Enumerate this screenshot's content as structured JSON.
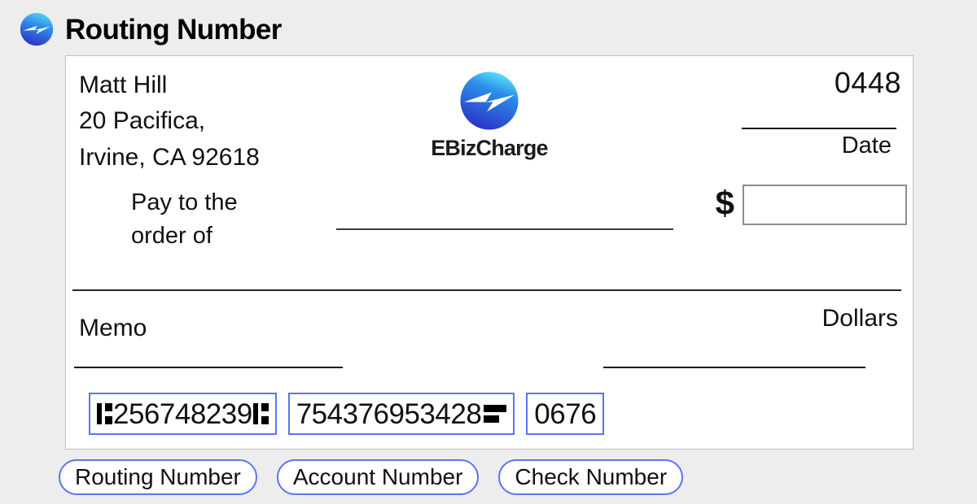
{
  "header": {
    "title": "Routing Number",
    "logo_icon": "ebizcharge-bolt-circle-icon"
  },
  "theme": {
    "page_background": "#ededed",
    "check_background": "#ffffff",
    "check_border": "#bdbdbd",
    "highlight_blue": "#5b74f0",
    "rule_color": "#1a1a1a",
    "amount_box_border": "#8d8d8d",
    "logo_gradient_from": "#3ec6f0",
    "logo_gradient_to": "#2a35c8"
  },
  "check": {
    "payer": {
      "name": "Matt Hill",
      "address_line1": "20 Pacifica,",
      "address_line2": "Irvine, CA 92618"
    },
    "bank_logo": {
      "icon": "ebizcharge-bolt-circle-icon",
      "wordmark": "EBizCharge"
    },
    "check_number_printed": "0448",
    "date_label": "Date",
    "pay_to_label_line1": "Pay to the",
    "pay_to_label_line2": "order of",
    "pay_to_value": "",
    "currency_symbol": "$",
    "amount_value": "",
    "amount_placeholder": "",
    "dollars_label": "Dollars",
    "memo_label": "Memo",
    "memo_value": "",
    "signature_value": ""
  },
  "micr": {
    "transit_symbol": "transit-symbol-icon",
    "onus_symbol": "on-us-symbol-icon",
    "routing_number": "256748239",
    "account_number": "754376953428",
    "check_number": "0676"
  },
  "callouts": [
    {
      "label": "Routing Number",
      "target": "routing-number-field"
    },
    {
      "label": "Account Number",
      "target": "account-number-field"
    },
    {
      "label": "Check Number",
      "target": "check-number-field"
    }
  ]
}
